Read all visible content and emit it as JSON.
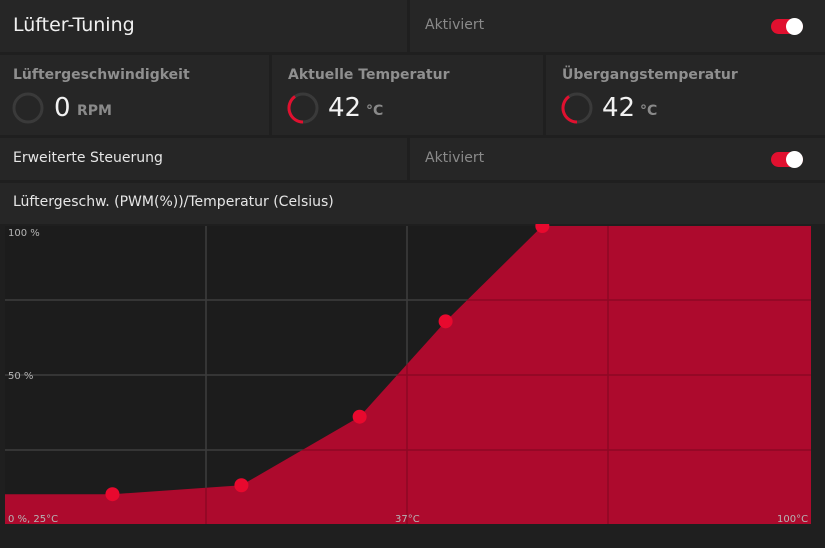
{
  "header": {
    "title": "Lüfter-Tuning",
    "status": "Aktiviert"
  },
  "stats": [
    {
      "label": "Lüftergeschwindigkeit",
      "value": "0",
      "unit": "RPM",
      "gauge_fraction": 0.0
    },
    {
      "label": "Aktuelle Temperatur",
      "value": "42",
      "unit": "°C",
      "gauge_fraction": 0.42
    },
    {
      "label": "Übergangstemperatur",
      "value": "42",
      "unit": "°C",
      "gauge_fraction": 0.42
    }
  ],
  "advanced": {
    "label": "Erweiterte Steuerung",
    "status": "Aktiviert"
  },
  "chart_section": {
    "title": "Lüftergeschw. (PWM(%))/Temperatur (Celsius)"
  },
  "chart_data": {
    "type": "area",
    "x_unit": "°C",
    "y_unit": "%",
    "xlim": [
      25,
      100
    ],
    "ylim": [
      0,
      100
    ],
    "tick_labels": {
      "y_top": "100 %",
      "y_mid": "50 %",
      "origin": "0 %, 25°C",
      "x_mid": "37°C",
      "x_max": "100°C"
    },
    "points": [
      {
        "x": 35,
        "y": 10
      },
      {
        "x": 47,
        "y": 13
      },
      {
        "x": 58,
        "y": 36
      },
      {
        "x": 66,
        "y": 68
      },
      {
        "x": 75,
        "y": 100
      }
    ],
    "edge_values": {
      "y_at_xmin": 10,
      "y_at_xmax": 100
    },
    "grid": true
  },
  "colors": {
    "accent": "#e0102f",
    "area_fill": "#ad0a2d",
    "point": "#e8092e",
    "panel": "#262626",
    "background": "#1f1f1f"
  }
}
